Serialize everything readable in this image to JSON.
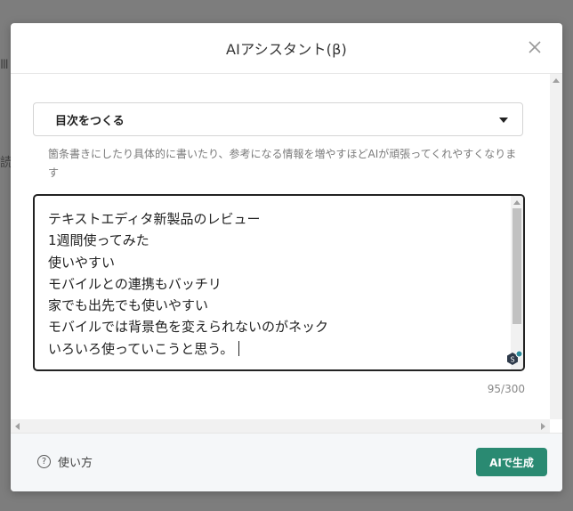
{
  "background": {
    "glyph_top": "Ⅲ",
    "glyph_mid": "読"
  },
  "modal": {
    "title": "AIアシスタント(β)",
    "close_icon": "close-icon"
  },
  "form": {
    "select_value": "目次をつくる",
    "hint": "箇条書きにしたり具体的に書いたり、参考になる情報を増やすほどAIが頑張ってくれやすくなります",
    "textarea_lines": [
      "テキストエディタ新製品のレビュー",
      "1週間使ってみた",
      "使いやすい",
      "モバイルとの連携もバッチリ",
      "家でも出先でも使いやすい",
      "モバイルでは背景色を変えられないのがネック",
      "いろいろ使っていこうと思う。"
    ],
    "counter": "95/300"
  },
  "footer": {
    "help_label": "使い方",
    "generate_label": "AIで生成"
  },
  "colors": {
    "accent": "#2a8a72",
    "overlay": "#7d7d7d"
  }
}
